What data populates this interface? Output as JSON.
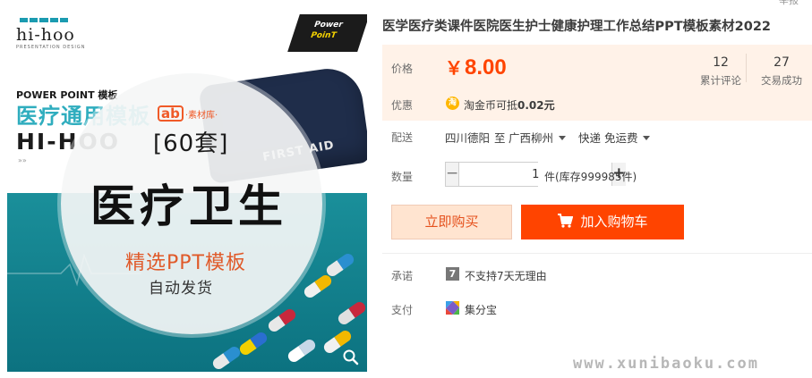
{
  "image": {
    "brand_logo": "hi-hoo",
    "badge_line1": "Power",
    "badge_line2": "PoinT",
    "small_title": "POWER POINT 模板",
    "cyan_title": "医疗通用模板",
    "hihoo_text": "HI-HOO",
    "arrows": "»»",
    "bag_label": "FIRST AID",
    "sucai_mark": "ab",
    "sucai_text": "素材库",
    "set_count": "[60套]",
    "main_title": "医疗卫生",
    "sub_title": "精选PPT模板",
    "sub_title2": "自动发货",
    "colors": {
      "teal": "#0c7280",
      "orange": "#e05a2a"
    }
  },
  "product": {
    "title": "医学医疗类课件医院医生护士健康护理工作总结PPT模板素材2022",
    "top_cut_text": "举报"
  },
  "price": {
    "label": "价格",
    "currency": "￥",
    "value": "8.00",
    "reviews_count": "12",
    "reviews_label": "累计评论",
    "deals_count": "27",
    "deals_label": "交易成功"
  },
  "promo": {
    "label": "优惠",
    "icon_text": "淘",
    "text_prefix": "淘金币可抵",
    "amount": "0.02元"
  },
  "shipping": {
    "label": "配送",
    "from": "四川德阳",
    "to_word": "至",
    "destination": "广西柳州",
    "method": "快递 免运费"
  },
  "quantity": {
    "label": "数量",
    "minus": "−",
    "value": "1",
    "plus": "+",
    "stock": "件(库存999985件)"
  },
  "actions": {
    "buy_now": "立即购买",
    "add_cart": "加入购物车"
  },
  "promise": {
    "label": "承诺",
    "icon_text": "7",
    "text": "不支持7天无理由"
  },
  "payment": {
    "label": "支付",
    "text": "集分宝"
  },
  "watermark": "www.xunibaoku.com"
}
